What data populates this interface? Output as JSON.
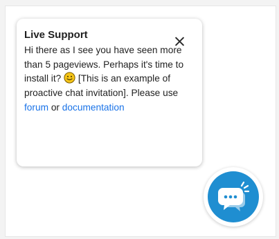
{
  "invitation": {
    "title": "Live Support",
    "text_before_emoji": "Hi there as I see you have seen more than 5 pageviews. Perhaps it's time to install it?",
    "text_after_emoji": "[This is an example of proactive chat invitation]. Please use",
    "forum_link": "forum",
    "connector": "or",
    "documentation_link": "documentation",
    "close_icon": "close-icon",
    "emoji_icon": "slightly-smiling-face-icon"
  },
  "launcher": {
    "icon": "chat-bubbles-icon",
    "color": "#1f8ed1"
  },
  "colors": {
    "link": "#1a73e8",
    "emoji": "#f5c518"
  }
}
